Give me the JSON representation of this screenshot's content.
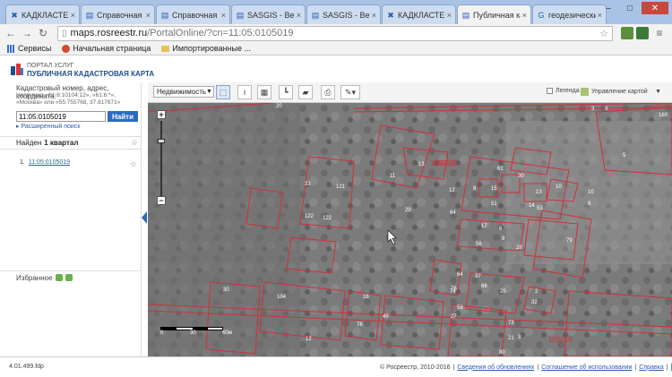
{
  "browser": {
    "tabs": [
      {
        "label": "КАДКЛАСТЕР",
        "icon": "kadcluster-icon",
        "active": false
      },
      {
        "label": "Справочная и",
        "icon": "page-icon",
        "active": false
      },
      {
        "label": "Справочная и",
        "icon": "page-icon",
        "active": false
      },
      {
        "label": "SASGIS - Веб-",
        "icon": "page-icon",
        "active": false
      },
      {
        "label": "SASGIS - Веб-",
        "icon": "page-icon",
        "active": false
      },
      {
        "label": "КАДКЛАСТЕР",
        "icon": "kadcluster-icon",
        "active": false
      },
      {
        "label": "Публичная кад",
        "icon": "page-icon",
        "active": true
      },
      {
        "label": "геодезически",
        "icon": "google-icon",
        "active": false
      }
    ],
    "address_host": "maps.rosreestr.ru",
    "address_path": "/PortalOnline/?cn=11:05:0105019",
    "bookmarks": [
      {
        "label": "Сервисы",
        "icon": "apps-icon"
      },
      {
        "label": "Начальная страница",
        "icon": "home-page-icon"
      },
      {
        "label": "Импортированные ...",
        "icon": "folder-icon"
      }
    ]
  },
  "portal": {
    "line1": "ПОРТАЛ УСЛУГ",
    "line2": "ПУБЛИЧНАЯ КАДАСТРОВАЯ КАРТА"
  },
  "search": {
    "label": "Кадастровый номер, адрес, координата:",
    "example": "Например «61:6:10104:12», «61:6:*», «Москва» или «55.755768, 37.617671»",
    "value": "11:05:0105019",
    "button": "Найти",
    "advanced": "Расширенный поиск"
  },
  "results": {
    "found_prefix": "Найден",
    "found_value": "1 квартал",
    "items": [
      {
        "num": "1.",
        "label": "11:05:0105019"
      }
    ]
  },
  "favorites": {
    "label": "Избранное"
  },
  "map_toolbar": {
    "layer": "Недвижимость",
    "legend": "Легенда",
    "map_control": "Управление картой"
  },
  "map": {
    "scale_labels": [
      "0",
      "30",
      "60м"
    ],
    "parcel_labels": [
      "20",
      "33",
      "121",
      "122",
      "122",
      "105019",
      "13",
      "11",
      "61",
      "30",
      "10",
      "8",
      "12",
      "15",
      "13",
      "51",
      "14",
      "53",
      "10",
      "8",
      "64",
      "17",
      "6",
      "29",
      "56",
      "28",
      "9",
      "79",
      "64",
      "37",
      "74",
      "66",
      "20",
      "2",
      "30",
      "32",
      "104",
      "16",
      "49",
      "27",
      "58",
      "105019",
      "76",
      "76",
      "73",
      "21",
      "12",
      "3",
      "105019",
      "80",
      "3",
      "105019",
      "9",
      "160",
      "5"
    ]
  },
  "footer": {
    "version": "4.01.499.fdp",
    "copyright": "© Росреестр, 2010-2016",
    "links": [
      "Сведения об обновлениях",
      "Соглашение об использовании",
      "Справка"
    ]
  }
}
